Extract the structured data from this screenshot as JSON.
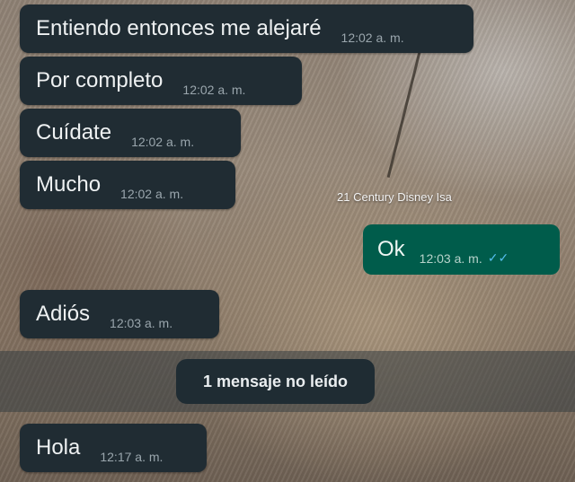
{
  "incoming_messages": [
    {
      "text": "Entiendo entonces me alejaré",
      "time": "12:02 a. m."
    },
    {
      "text": "Por completo",
      "time": "12:02 a. m."
    },
    {
      "text": "Cuídate",
      "time": "12:02 a. m."
    },
    {
      "text": "Mucho",
      "time": "12:02 a. m."
    },
    {
      "text": "Adiós",
      "time": "12:03 a. m."
    },
    {
      "text": "Hola",
      "time": "12:17 a. m."
    }
  ],
  "outgoing_message": {
    "text": "Ok",
    "time": "12:03 a. m.",
    "status_icon": "double-check-icon"
  },
  "watermark": "21 Century Disney Isa",
  "unread_banner": "1 mensaje no leído",
  "colors": {
    "incoming_bubble": "#202c33",
    "outgoing_bubble": "#005c4b",
    "read_ticks": "#53bdeb"
  }
}
